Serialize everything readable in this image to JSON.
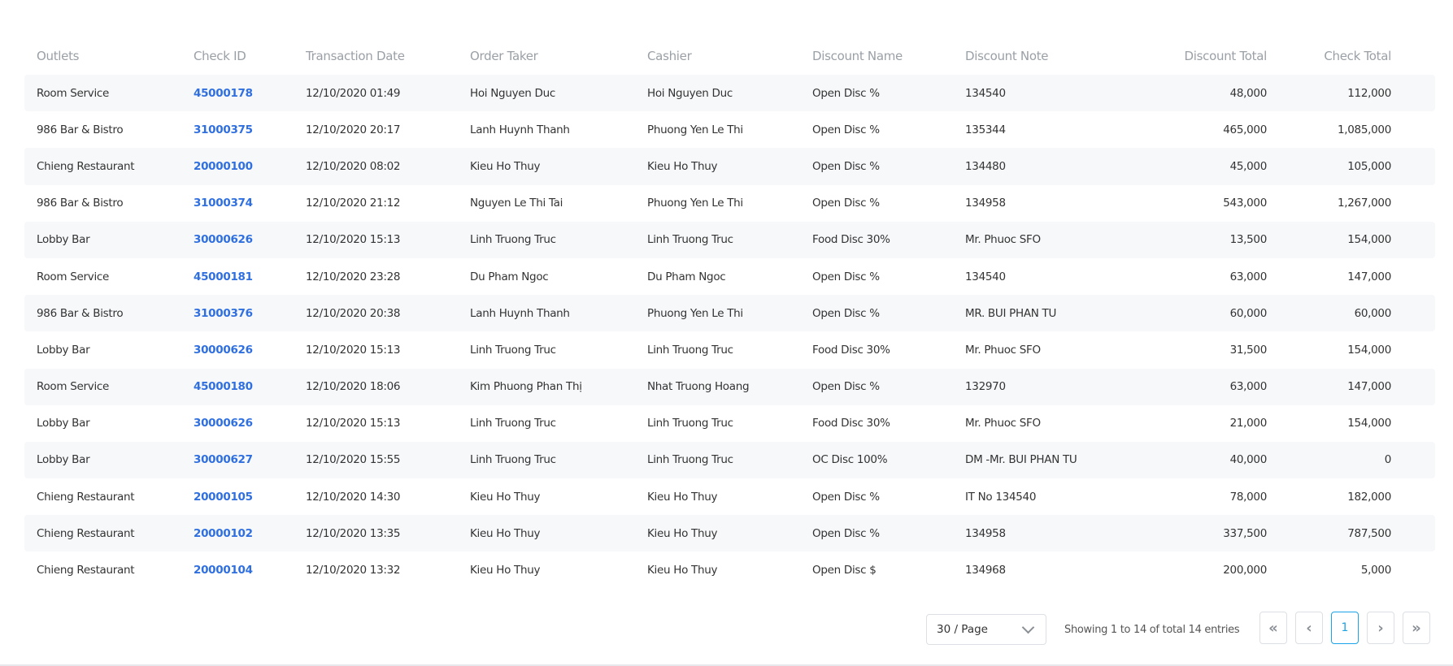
{
  "columns": [
    "Outlets",
    "Check ID",
    "Transaction Date",
    "Order Taker",
    "Cashier",
    "Discount Name",
    "Discount Note",
    "Discount Total",
    "Check Total"
  ],
  "rows": [
    [
      "Room Service",
      "45000178",
      "12/10/2020 01:49",
      "Hoi Nguyen Duc",
      "Hoi Nguyen Duc",
      "Open Disc %",
      "134540",
      "48,000",
      "112,000"
    ],
    [
      "986 Bar & Bistro",
      "31000375",
      "12/10/2020 20:17",
      "Lanh Huynh Thanh",
      "Phuong Yen Le Thi",
      "Open Disc %",
      "135344",
      "465,000",
      "1,085,000"
    ],
    [
      "Chieng Restaurant",
      "20000100",
      "12/10/2020 08:02",
      "Kieu Ho Thuy",
      "Kieu Ho Thuy",
      "Open Disc %",
      "134480",
      "45,000",
      "105,000"
    ],
    [
      "986 Bar & Bistro",
      "31000374",
      "12/10/2020 21:12",
      "Nguyen Le Thi Tai",
      "Phuong Yen Le Thi",
      "Open Disc %",
      "134958",
      "543,000",
      "1,267,000"
    ],
    [
      "Lobby Bar",
      "30000626",
      "12/10/2020 15:13",
      "Linh Truong Truc",
      "Linh Truong Truc",
      "Food Disc 30%",
      "Mr. Phuoc SFO",
      "13,500",
      "154,000"
    ],
    [
      "Room Service",
      "45000181",
      "12/10/2020 23:28",
      "Du Pham Ngoc",
      "Du Pham Ngoc",
      "Open Disc %",
      "134540",
      "63,000",
      "147,000"
    ],
    [
      "986 Bar & Bistro",
      "31000376",
      "12/10/2020 20:38",
      "Lanh Huynh Thanh",
      "Phuong Yen Le Thi",
      "Open Disc %",
      "MR. BUI PHAN TU",
      "60,000",
      "60,000"
    ],
    [
      "Lobby Bar",
      "30000626",
      "12/10/2020 15:13",
      "Linh Truong Truc",
      "Linh Truong Truc",
      "Food Disc 30%",
      "Mr. Phuoc SFO",
      "31,500",
      "154,000"
    ],
    [
      "Room Service",
      "45000180",
      "12/10/2020 18:06",
      "Kim Phuong Phan Thị",
      "Nhat Truong Hoang",
      "Open Disc %",
      "132970",
      "63,000",
      "147,000"
    ],
    [
      "Lobby Bar",
      "30000626",
      "12/10/2020 15:13",
      "Linh Truong Truc",
      "Linh Truong Truc",
      "Food Disc 30%",
      "Mr. Phuoc SFO",
      "21,000",
      "154,000"
    ],
    [
      "Lobby Bar",
      "30000627",
      "12/10/2020 15:55",
      "Linh Truong Truc",
      "Linh Truong Truc",
      "OC Disc 100%",
      "DM -Mr. BUI PHAN TU",
      "40,000",
      "0"
    ],
    [
      "Chieng Restaurant",
      "20000105",
      "12/10/2020 14:30",
      "Kieu Ho Thuy",
      "Kieu Ho Thuy",
      "Open Disc %",
      "IT No 134540",
      "78,000",
      "182,000"
    ],
    [
      "Chieng Restaurant",
      "20000102",
      "12/10/2020 13:35",
      "Kieu Ho Thuy",
      "Kieu Ho Thuy",
      "Open Disc %",
      "134958",
      "337,500",
      "787,500"
    ],
    [
      "Chieng Restaurant",
      "20000104",
      "12/10/2020 13:32",
      "Kieu Ho Thuy",
      "Kieu Ho Thuy",
      "Open Disc $",
      "134968",
      "200,000",
      "5,000"
    ]
  ],
  "pagination": {
    "page_size": "30 / Page",
    "summary": "Showing 1 to 14 of total 14 entries",
    "first": "«",
    "prev": "‹",
    "current": "1",
    "next": "›",
    "last": "»"
  },
  "colors": {
    "link": "#2f6fe0",
    "active": "#1aa3e8",
    "row_stripe": "#f7f8fa"
  }
}
